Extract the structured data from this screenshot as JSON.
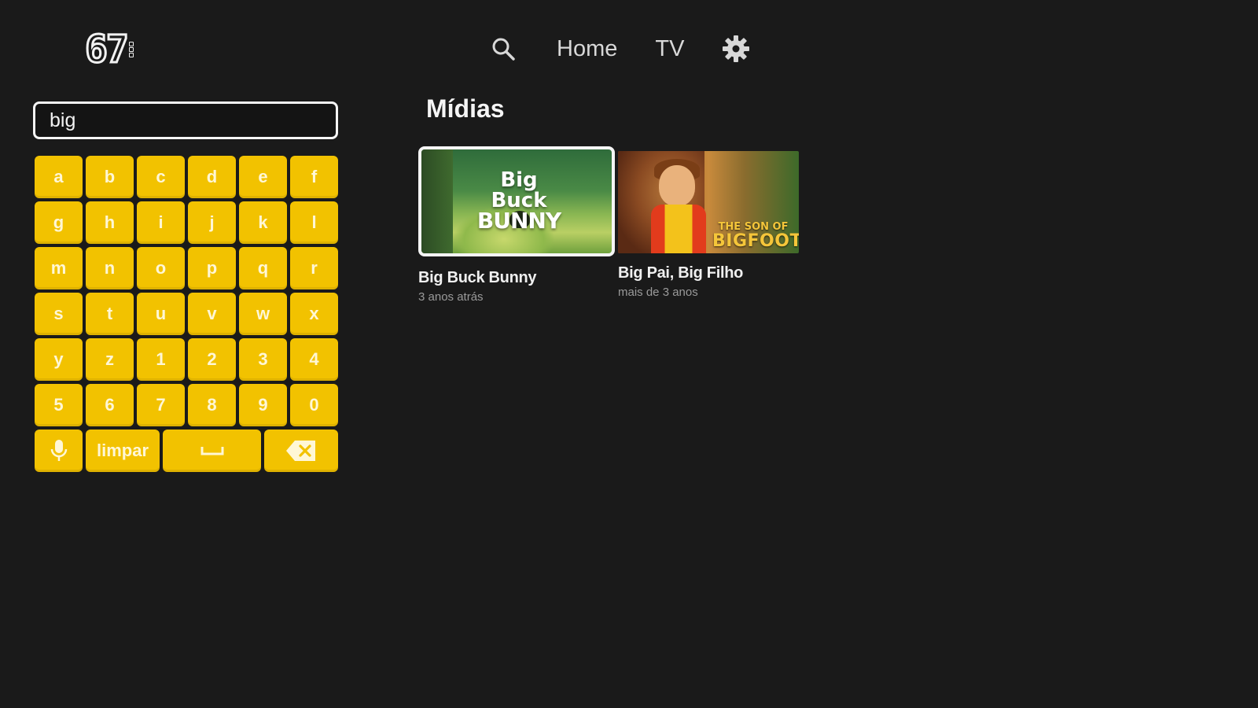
{
  "app": {
    "logo_text": "67"
  },
  "nav": {
    "search_icon": "search-icon",
    "items": [
      {
        "label": "Home"
      },
      {
        "label": "TV"
      }
    ],
    "settings_icon": "gear-icon"
  },
  "search": {
    "value": "big"
  },
  "keyboard": {
    "rows": [
      [
        "a",
        "b",
        "c",
        "d",
        "e",
        "f"
      ],
      [
        "g",
        "h",
        "i",
        "j",
        "k",
        "l"
      ],
      [
        "m",
        "n",
        "o",
        "p",
        "q",
        "r"
      ],
      [
        "s",
        "t",
        "u",
        "v",
        "w",
        "x"
      ],
      [
        "y",
        "z",
        "1",
        "2",
        "3",
        "4"
      ],
      [
        "5",
        "6",
        "7",
        "8",
        "9",
        "0"
      ]
    ],
    "clear_label": "limpar",
    "mic_icon": "microphone-icon",
    "space_icon": "space-bar-icon",
    "backspace_icon": "backspace-icon",
    "key_color": "#f2c200"
  },
  "results": {
    "section_title": "Mídias",
    "items": [
      {
        "title": "Big Buck Bunny",
        "subtitle": "3 anos atrás",
        "thumb_text_line1": "Big Buck",
        "thumb_text_line2": "BUNNY"
      },
      {
        "title": "Big Pai, Big Filho",
        "subtitle": "mais de 3 anos",
        "thumb_text_line1": "THE SON OF",
        "thumb_text_line2": "BIGFOOT"
      }
    ]
  },
  "colors": {
    "background": "#1a1a1a",
    "accent": "#f2c200",
    "focus_border": "#f5f5f5"
  }
}
